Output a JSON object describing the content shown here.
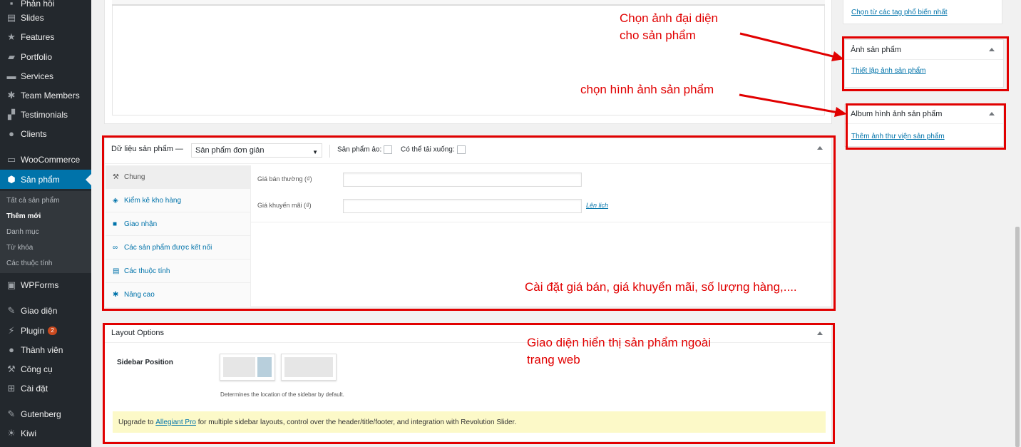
{
  "menu": [
    {
      "label": "Phản hồi",
      "icon": "comment-icon"
    },
    {
      "label": "Slides",
      "icon": "slides-icon"
    },
    {
      "label": "Features",
      "icon": "star-icon"
    },
    {
      "label": "Portfolio",
      "icon": "folder-icon"
    },
    {
      "label": "Services",
      "icon": "services-icon"
    },
    {
      "label": "Team Members",
      "icon": "team-icon"
    },
    {
      "label": "Testimonials",
      "icon": "testimonials-icon"
    },
    {
      "label": "Clients",
      "icon": "user-icon"
    },
    {
      "label": "WooCommerce",
      "icon": "woo-icon"
    },
    {
      "label": "Sản phẩm",
      "icon": "product-icon"
    },
    {
      "label": "WPForms",
      "icon": "forms-icon"
    },
    {
      "label": "Giao diện",
      "icon": "brush-icon"
    },
    {
      "label": "Plugin",
      "icon": "plugin-icon",
      "badge": "2"
    },
    {
      "label": "Thành viên",
      "icon": "users-icon"
    },
    {
      "label": "Công cụ",
      "icon": "wrench-icon"
    },
    {
      "label": "Cài đặt",
      "icon": "settings-icon"
    },
    {
      "label": "Gutenberg",
      "icon": "gutenberg-icon"
    },
    {
      "label": "Kiwi",
      "icon": "kiwi-icon"
    }
  ],
  "submenu": [
    "Tất cả sản phẩm",
    "Thêm mới",
    "Danh mục",
    "Từ khóa",
    "Các thuộc tính"
  ],
  "right": {
    "tags_link": "Chọn từ các tag phổ biến nhất",
    "image_title": "Ảnh sản phẩm",
    "image_link": "Thiết lập ảnh sản phẩm",
    "gallery_title": "Album hình ảnh sản phẩm",
    "gallery_link": "Thêm ảnh thư viện sản phẩm"
  },
  "product_data": {
    "title": "Dữ liệu sản phẩm —",
    "type_select": "Sản phẩm đơn giản",
    "virtual_label": "Sản phẩm ảo:",
    "download_label": "Có thể tải xuống:",
    "tabs": [
      "Chung",
      "Kiểm kê kho hàng",
      "Giao nhận",
      "Các sản phẩm được kết nối",
      "Các thuộc tính",
      "Nâng cao"
    ],
    "regular_price_label": "Giá bán thường (₫)",
    "sale_price_label": "Giá khuyến mãi (₫)",
    "schedule_link": "Lên lịch"
  },
  "layout_options": {
    "title": "Layout Options",
    "sidebar_position_label": "Sidebar Position",
    "description": "Determines the location of the sidebar by default.",
    "upgrade_prefix": "Upgrade to ",
    "upgrade_link": "Allegiant Pro",
    "upgrade_suffix": " for multiple sidebar layouts, control over the header/title/footer, and integration with Revolution Slider."
  },
  "annotations": {
    "featured_line1": "Chọn ảnh đại diện",
    "featured_line2": "cho sản phẩm",
    "gallery": "chọn hình ảnh sản phẩm",
    "pricing": "Cài đặt giá bán, giá khuyển mãi, số lượng hàng,....",
    "layout_line1": "Giao diện hiển thị sản phẩm ngoài",
    "layout_line2": "trang web"
  },
  "colors": {
    "highlight": "#e10000",
    "admin_menu": "#23282d",
    "accent": "#0073aa"
  }
}
